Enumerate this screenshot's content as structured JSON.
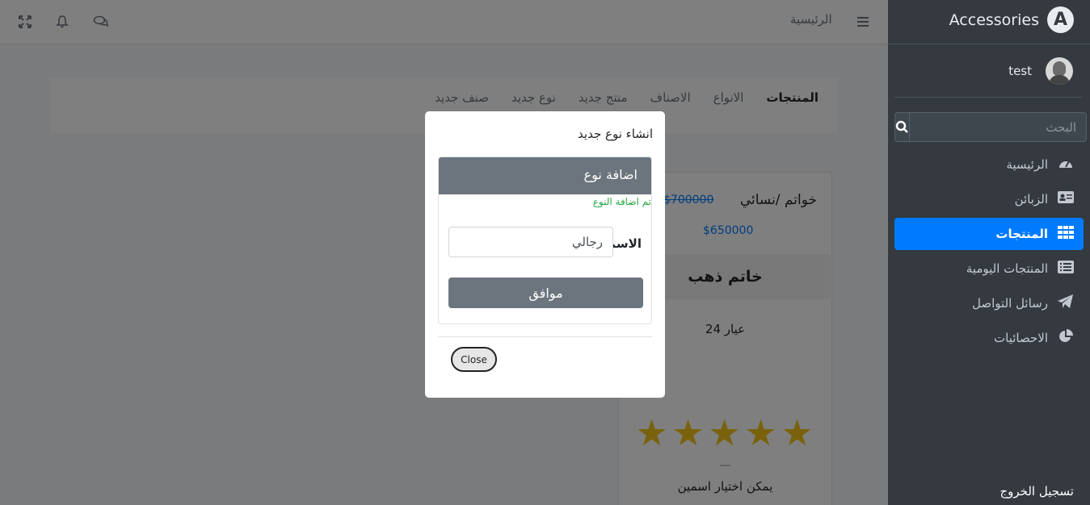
{
  "navbar": {
    "home_link": "الرئيسية",
    "icons": [
      "fullscreen-icon",
      "bell-icon",
      "comments-icon",
      "hamburger-icon"
    ]
  },
  "tabs": [
    "المنتجات",
    "الانواع",
    "الاصناف",
    "منتج جديد",
    "نوع جديد",
    "صنف جديد"
  ],
  "product": {
    "name": "خواتم /نسائي",
    "old_price": "$700000",
    "new_price": "$650000",
    "title": "خاتم ذهب",
    "karat": "عيار 24",
    "rating": 5,
    "dash": "—",
    "description": "يمكن اختيار اسمين"
  },
  "sidebar": {
    "brand": "Accessories",
    "brand_logo": "A",
    "user": "test",
    "search_placeholder": "البحث",
    "items": [
      {
        "label": "الرئيسية",
        "icon": "dashboard-icon"
      },
      {
        "label": "الزبائن",
        "icon": "id-card-icon"
      },
      {
        "label": "المنتجات",
        "icon": "grid-icon",
        "active": true
      },
      {
        "label": "المنتجات اليومية",
        "icon": "list-icon"
      },
      {
        "label": "رسائل التواصل",
        "icon": "paper-plane-icon"
      },
      {
        "label": "الاحصائيات",
        "icon": "pie-chart-icon"
      }
    ],
    "logout": "تسجيل الخروج"
  },
  "modal": {
    "title": "انشاء نوع جديد",
    "card_header": "اضافة نوع",
    "success": "تم اضافة النوع",
    "name_label": "الاسم",
    "name_value": "رجالي",
    "ok_label": "موافق",
    "close_label": "Close"
  },
  "colors": {
    "sidebar_bg": "#343a40",
    "active": "#007bff",
    "success": "#28a745",
    "star": "#f5c518"
  }
}
